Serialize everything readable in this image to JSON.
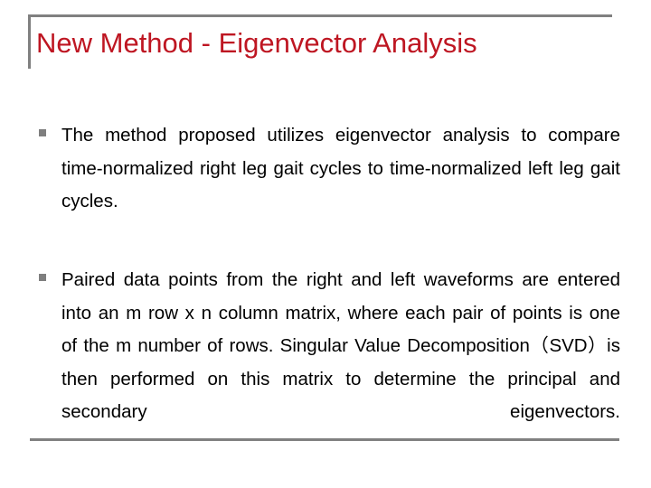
{
  "slide": {
    "title": "New Method - Eigenvector Analysis",
    "title_color": "#BE1622",
    "rule_color": "#808080",
    "bullet_color": "#7F7F7F",
    "body_color": "#000000",
    "background_color": "#FFFFFF",
    "bullets": [
      {
        "marker": "square-bullet-icon",
        "text": "The method proposed utilizes eigenvector analysis to compare time-normalized right leg gait cycles to time-normalized left leg gait cycles."
      },
      {
        "marker": "square-bullet-icon",
        "text": "Paired data points from the right and left waveforms are entered into an m row x n column matrix, where each pair of points is one of the m number of rows.  Singular Value Decomposition（SVD）is then performed on this matrix to determine the principal and secondary eigenvectors."
      }
    ]
  }
}
